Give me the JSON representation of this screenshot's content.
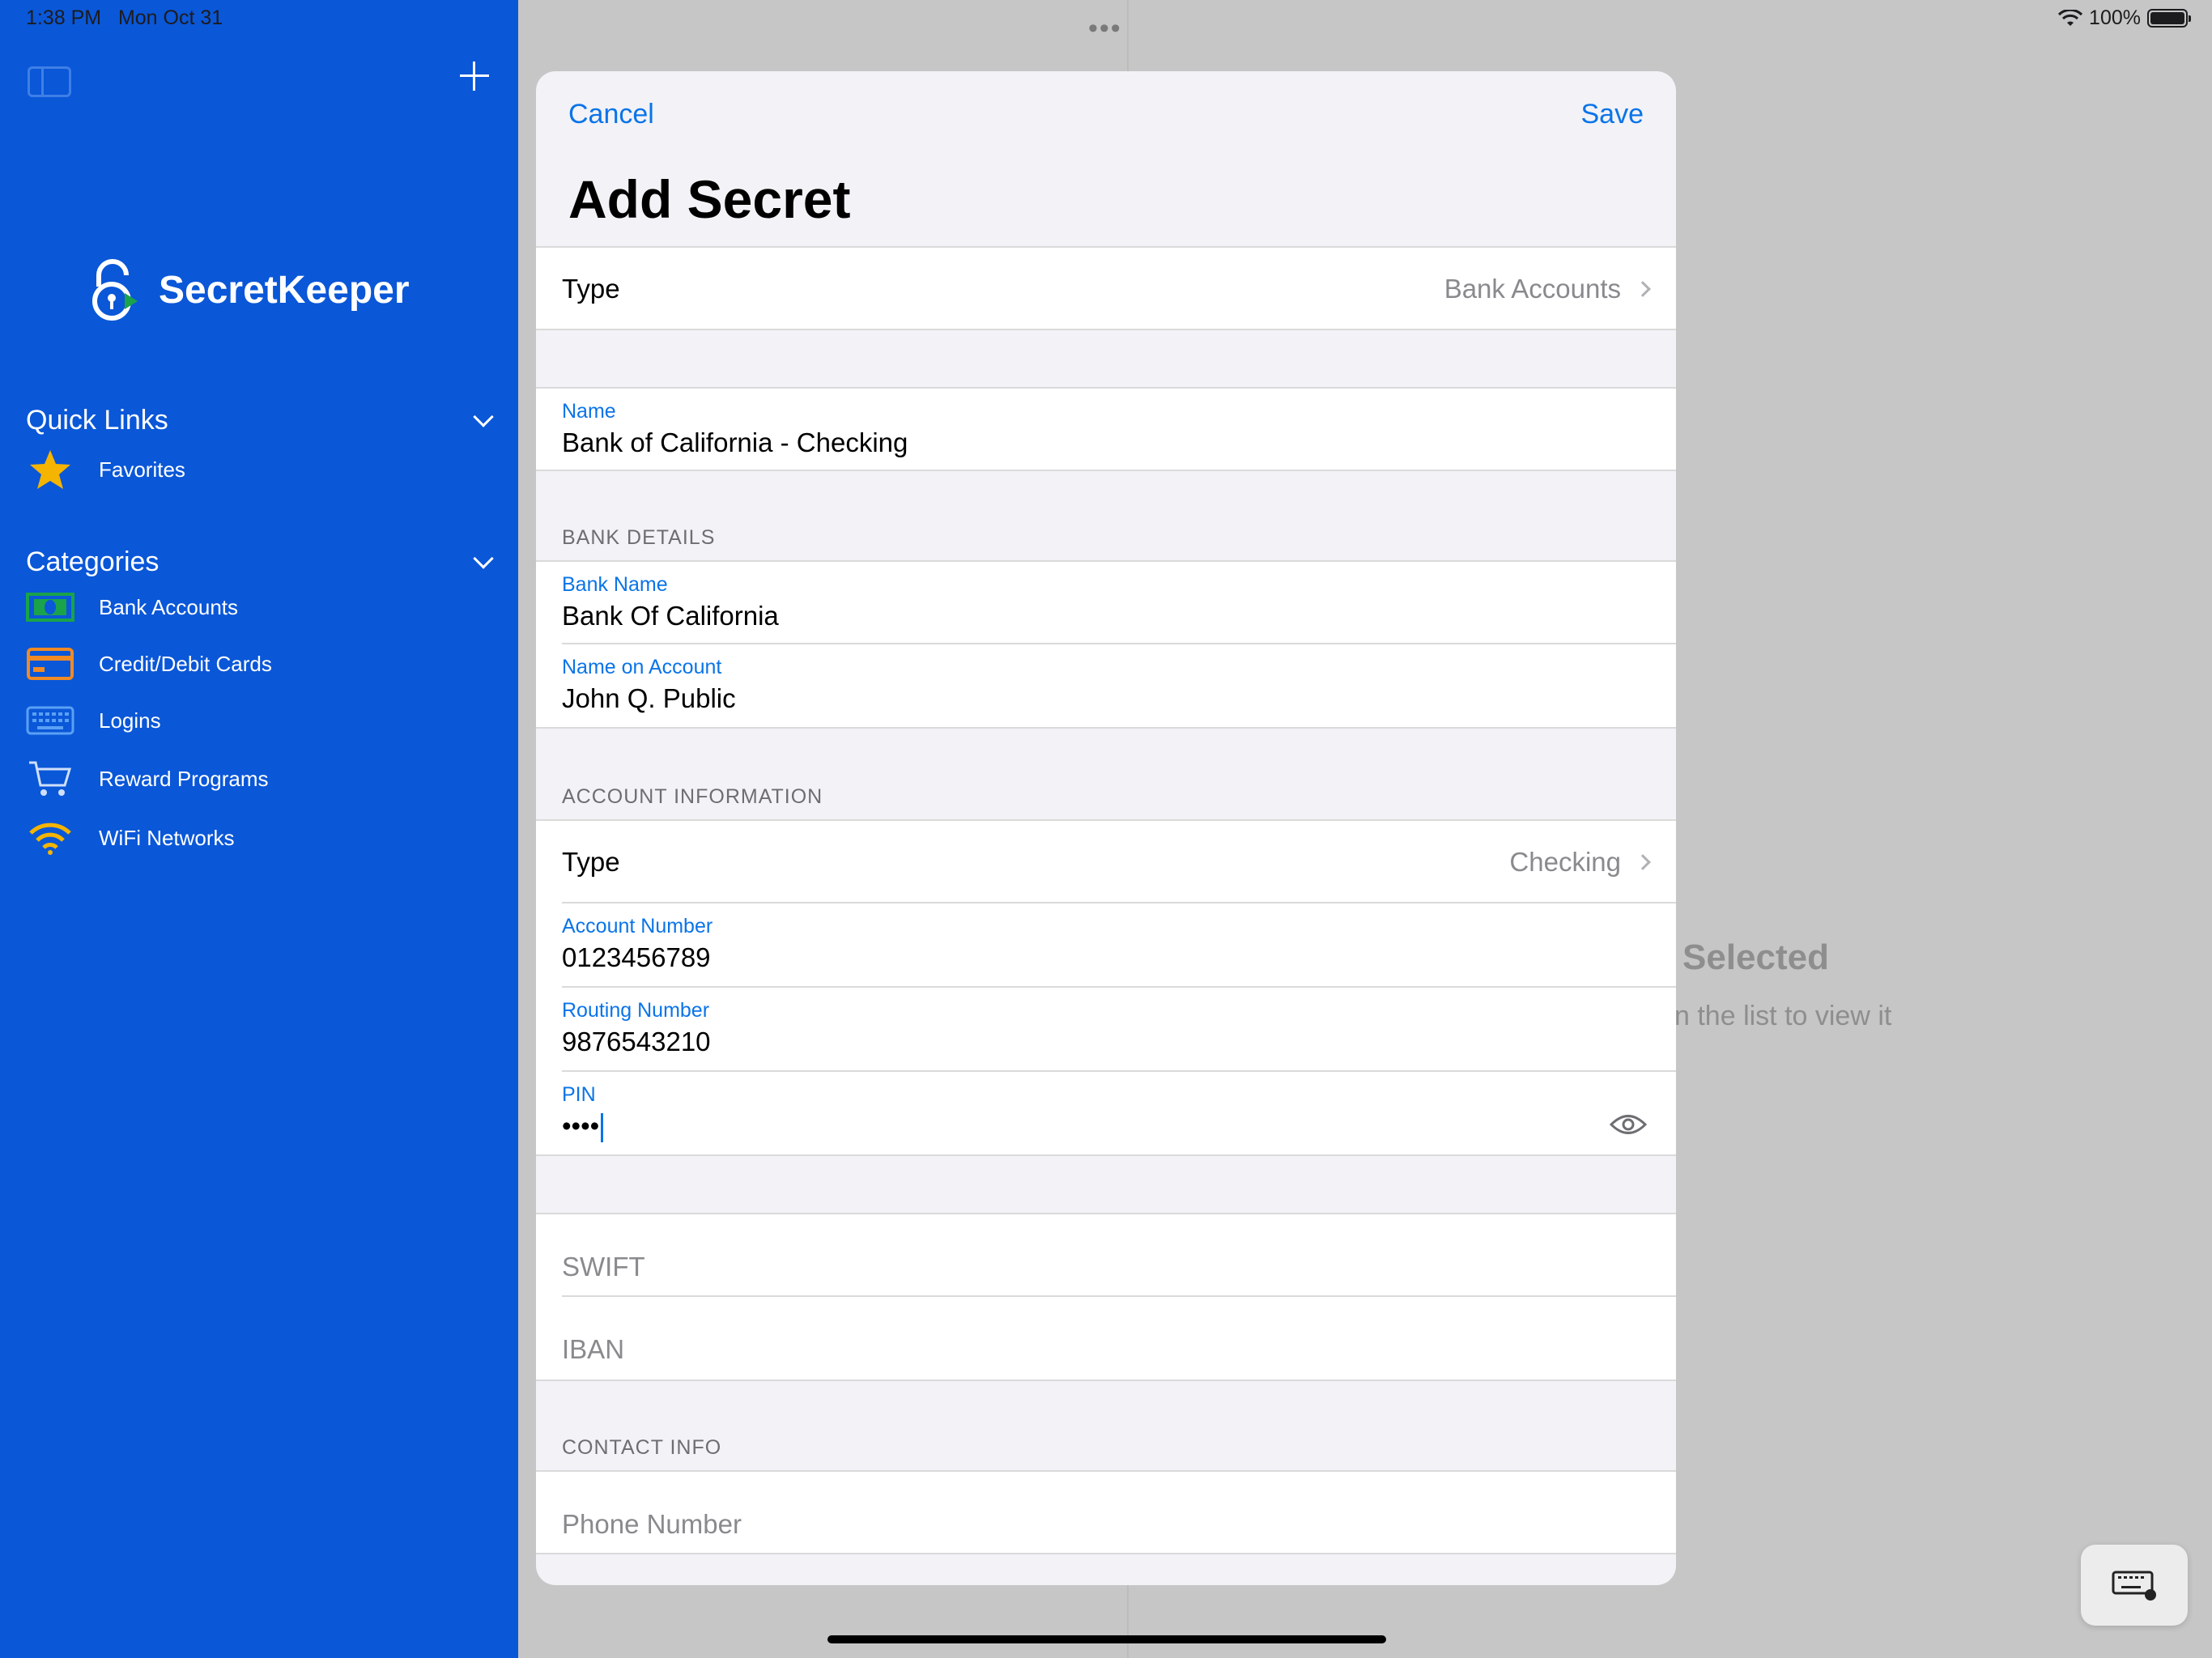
{
  "status_bar": {
    "time": "1:38 PM",
    "date": "Mon Oct 31",
    "battery": "100%"
  },
  "sidebar": {
    "app_name": "SecretKeeper",
    "quick_links": {
      "title": "Quick Links",
      "items": [
        {
          "label": "Favorites",
          "icon": "star-icon"
        }
      ]
    },
    "categories": {
      "title": "Categories",
      "items": [
        {
          "label": "Bank Accounts",
          "icon": "banknote-icon"
        },
        {
          "label": "Credit/Debit Cards",
          "icon": "credit-card-icon"
        },
        {
          "label": "Logins",
          "icon": "keyboard-icon"
        },
        {
          "label": "Reward Programs",
          "icon": "cart-icon"
        },
        {
          "label": "WiFi Networks",
          "icon": "wifi-icon"
        }
      ]
    }
  },
  "detail": {
    "empty_title": "Selected",
    "empty_subtitle": "n the list to view it"
  },
  "modal": {
    "cancel_label": "Cancel",
    "save_label": "Save",
    "title": "Add Secret",
    "type": {
      "label": "Type",
      "value": "Bank Accounts"
    },
    "name": {
      "caption": "Name",
      "value": "Bank of California - Checking"
    },
    "bank_details": {
      "header": "BANK DETAILS",
      "bank_name": {
        "caption": "Bank Name",
        "value": "Bank Of California"
      },
      "name_on_account": {
        "caption": "Name on Account",
        "value": "John Q. Public"
      }
    },
    "account_information": {
      "header": "ACCOUNT INFORMATION",
      "type": {
        "label": "Type",
        "value": "Checking"
      },
      "account_number": {
        "caption": "Account Number",
        "value": "0123456789"
      },
      "routing_number": {
        "caption": "Routing Number",
        "value": "9876543210"
      },
      "pin": {
        "caption": "PIN",
        "value": "••••"
      }
    },
    "swift_placeholder": "SWIFT",
    "iban_placeholder": "IBAN",
    "contact_info": {
      "header": "CONTACT INFO",
      "phone_placeholder": "Phone Number"
    }
  },
  "colors": {
    "sidebar": "#0a57d8",
    "accent": "#0a74e8",
    "star": "#f4b400",
    "bank_icon": "#1aa34a",
    "card_icon": "#f08a24",
    "wifi_icon": "#f4b400"
  }
}
